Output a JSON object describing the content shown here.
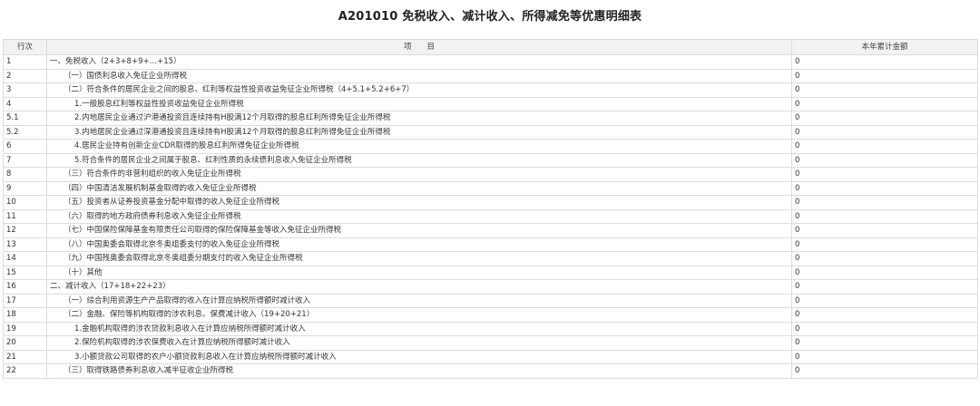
{
  "title": "A201010 免税收入、减计收入、所得减免等优惠明细表",
  "headers": {
    "row_no": "行次",
    "item": "项　　目",
    "amount": "本年累计金额"
  },
  "rows": [
    {
      "no": "1",
      "level": 0,
      "item": "一、免税收入（2+3+8+9+…+15）",
      "amount": "0"
    },
    {
      "no": "2",
      "level": 1,
      "item": "（一）国债利息收入免征企业所得税",
      "amount": "0"
    },
    {
      "no": "3",
      "level": 1,
      "item": "（二）符合条件的居民企业之间的股息、红利等权益性投资收益免征企业所得税（4+5.1+5.2+6+7）",
      "amount": "0"
    },
    {
      "no": "4",
      "level": 2,
      "item": "1.一般股息红利等权益性投资收益免征企业所得税",
      "amount": "0"
    },
    {
      "no": "5.1",
      "level": 2,
      "item": "2.内地居民企业通过沪港通投资且连续持有H股满12个月取得的股息红利所得免征企业所得税",
      "amount": "0"
    },
    {
      "no": "5.2",
      "level": 2,
      "item": "3.内地居民企业通过深港通投资且连续持有H股满12个月取得的股息红利所得免征企业所得税",
      "amount": "0"
    },
    {
      "no": "6",
      "level": 2,
      "item": "4.居民企业持有创新企业CDR取得的股息红利所得免征企业所得税",
      "amount": "0"
    },
    {
      "no": "7",
      "level": 2,
      "item": "5.符合条件的居民企业之间属于股息、红利性质的永续债利息收入免征企业所得税",
      "amount": "0"
    },
    {
      "no": "8",
      "level": 1,
      "item": "（三）符合条件的非营利组织的收入免征企业所得税",
      "amount": "0"
    },
    {
      "no": "9",
      "level": 1,
      "item": "（四）中国清洁发展机制基金取得的收入免征企业所得税",
      "amount": "0"
    },
    {
      "no": "10",
      "level": 1,
      "item": "（五）投资者从证券投资基金分配中取得的收入免征企业所得税",
      "amount": "0"
    },
    {
      "no": "11",
      "level": 1,
      "item": "（六）取得的地方政府债券利息收入免征企业所得税",
      "amount": "0"
    },
    {
      "no": "12",
      "level": 1,
      "item": "（七）中国保险保障基金有限责任公司取得的保险保障基金等收入免征企业所得税",
      "amount": "0"
    },
    {
      "no": "13",
      "level": 1,
      "item": "（八）中国奥委会取得北京冬奥组委支付的收入免征企业所得税",
      "amount": "0"
    },
    {
      "no": "14",
      "level": 1,
      "item": "（九）中国残奥委会取得北京冬奥组委分期支付的收入免征企业所得税",
      "amount": "0"
    },
    {
      "no": "15",
      "level": 1,
      "item": "（十）其他",
      "amount": "0"
    },
    {
      "no": "16",
      "level": 0,
      "item": "二、减计收入（17+18+22+23）",
      "amount": "0"
    },
    {
      "no": "17",
      "level": 1,
      "item": "（一）综合利用资源生产产品取得的收入在计算应纳税所得额时减计收入",
      "amount": "0"
    },
    {
      "no": "18",
      "level": 1,
      "item": "（二）金融、保险等机构取得的涉农利息、保费减计收入（19+20+21）",
      "amount": "0"
    },
    {
      "no": "19",
      "level": 2,
      "item": "1.金融机构取得的涉农贷款利息收入在计算应纳税所得额时减计收入",
      "amount": "0"
    },
    {
      "no": "20",
      "level": 2,
      "item": "2.保险机构取得的涉农保费收入在计算应纳税所得额时减计收入",
      "amount": "0"
    },
    {
      "no": "21",
      "level": 2,
      "item": "3.小额贷款公司取得的农户小额贷款利息收入在计算应纳税所得额时减计收入",
      "amount": "0"
    },
    {
      "no": "22",
      "level": 1,
      "item": "（三）取得铁路债券利息收入减半征收企业所得税",
      "amount": "0"
    }
  ]
}
